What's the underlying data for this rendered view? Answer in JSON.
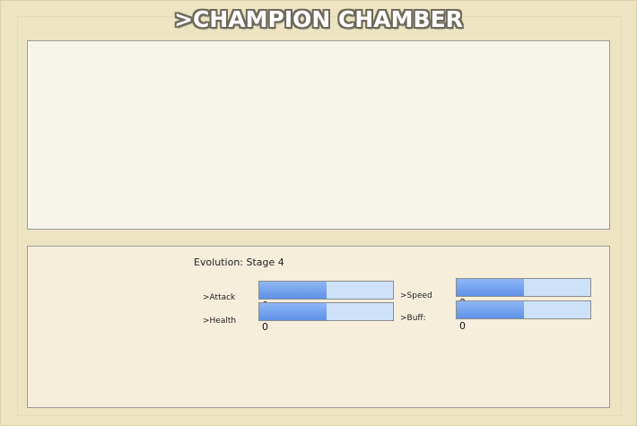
{
  "title": ">CHAMPION CHAMBER",
  "evolution_label": "Evolution: Stage 4",
  "stats": [
    {
      "key": "attack",
      "label": ">Attack",
      "value": "0",
      "fill_fraction": 0.5
    },
    {
      "key": "health",
      "label": ">Health",
      "value": "0",
      "fill_fraction": 0.5
    },
    {
      "key": "speed",
      "label": ">Speed",
      "value": "0",
      "fill_fraction": 0.5
    },
    {
      "key": "buff",
      "label": ">Buff:",
      "value": "0",
      "fill_fraction": 0.5
    }
  ],
  "colors": {
    "background": "#ece4c2",
    "top_panel": "#f7f5ea",
    "bottom_panel": "#f4eedb",
    "bar_fill": "#6f9fee",
    "bar_track": "#cde2f8"
  }
}
